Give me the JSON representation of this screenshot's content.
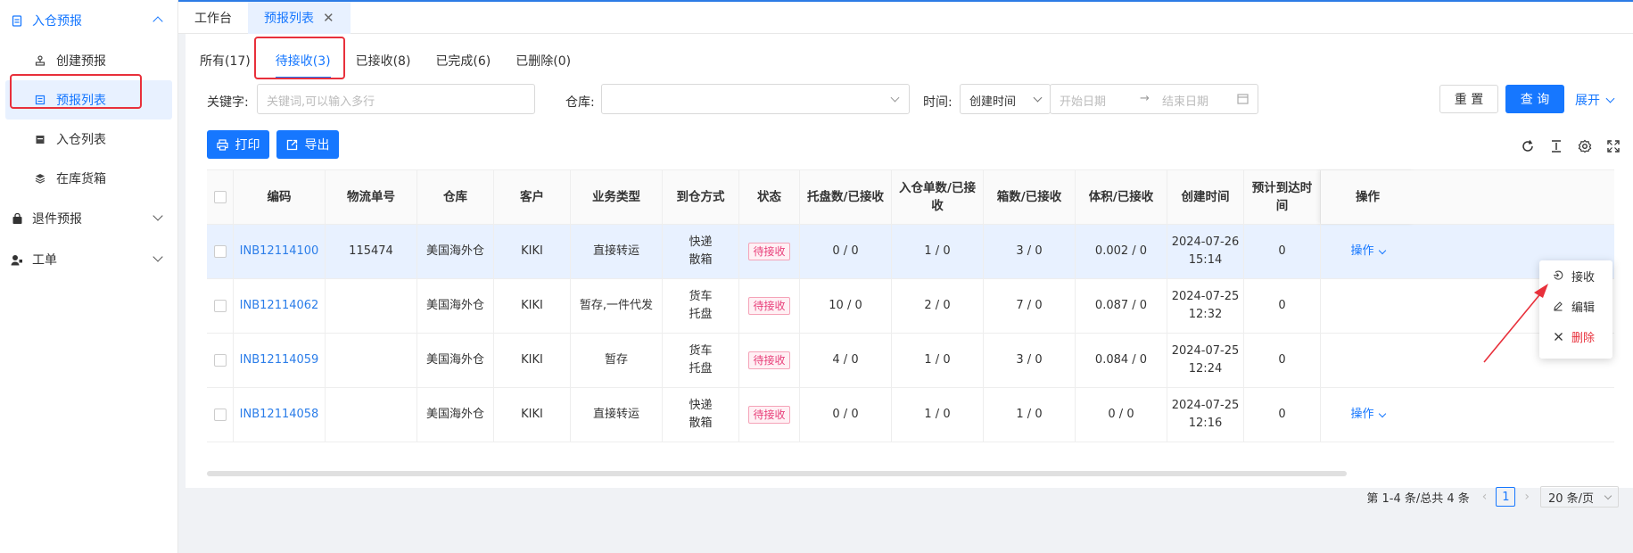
{
  "sidebar": {
    "groups": [
      {
        "label": "入仓预报",
        "icon": "document-icon",
        "open": true
      },
      {
        "label": "退件预报",
        "icon": "bag-icon"
      },
      {
        "label": "工单",
        "icon": "user-wrench-icon"
      }
    ],
    "items": [
      {
        "label": "创建预报",
        "icon": "stamp-icon"
      },
      {
        "label": "预报列表",
        "icon": "list-icon",
        "active": true
      },
      {
        "label": "入仓列表",
        "icon": "calendar-icon"
      },
      {
        "label": "在库货箱",
        "icon": "stack-icon"
      }
    ]
  },
  "top_tabs": [
    {
      "label": "工作台"
    },
    {
      "label": "预报列表",
      "active": true,
      "close": "✕"
    }
  ],
  "status_tabs": [
    {
      "label": "所有(17)"
    },
    {
      "label": "待接收(3)",
      "active": true
    },
    {
      "label": "已接收(8)"
    },
    {
      "label": "已完成(6)"
    },
    {
      "label": "已删除(0)"
    }
  ],
  "filters": {
    "keyword_label": "关键字:",
    "keyword_placeholder": "关键词,可以输入多行",
    "warehouse_label": "仓库:",
    "time_label": "时间:",
    "time_type": "创建时间",
    "start_placeholder": "开始日期",
    "arrow": "→",
    "end_placeholder": "结束日期",
    "reset": "重 置",
    "query": "查 询",
    "expand": "展开"
  },
  "actions": {
    "print": "打印",
    "export": "导出"
  },
  "table": {
    "headers": [
      "编码",
      "物流单号",
      "仓库",
      "客户",
      "业务类型",
      "到仓方式",
      "状态",
      "托盘数/已接收",
      "入仓单数/已接收",
      "箱数/已接收",
      "体积/已接收",
      "创建时间",
      "预计到达时间",
      "操作"
    ],
    "rows": [
      {
        "code": "INB12114100",
        "tracking": "115474",
        "warehouse": "美国海外仓",
        "customer": "KIKI",
        "biz": "直接转运",
        "arrival1": "快递",
        "arrival2": "散箱",
        "status": "待接收",
        "pallets": "0 / 0",
        "orders": "1 / 0",
        "boxes": "3 / 0",
        "volume": "0.002 / 0",
        "date": "2024-07-26",
        "time": "15:14",
        "eta": "0",
        "op": "操作"
      },
      {
        "code": "INB12114062",
        "tracking": "",
        "warehouse": "美国海外仓",
        "customer": "KIKI",
        "biz": "暂存,一件代发",
        "arrival1": "货车",
        "arrival2": "托盘",
        "status": "待接收",
        "pallets": "10 / 0",
        "orders": "2 / 0",
        "boxes": "7 / 0",
        "volume": "0.087 / 0",
        "date": "2024-07-25",
        "time": "12:32",
        "eta": "0",
        "op": ""
      },
      {
        "code": "INB12114059",
        "tracking": "",
        "warehouse": "美国海外仓",
        "customer": "KIKI",
        "biz": "暂存",
        "arrival1": "货车",
        "arrival2": "托盘",
        "status": "待接收",
        "pallets": "4 / 0",
        "orders": "1 / 0",
        "boxes": "3 / 0",
        "volume": "0.084 / 0",
        "date": "2024-07-25",
        "time": "12:24",
        "eta": "0",
        "op": ""
      },
      {
        "code": "INB12114058",
        "tracking": "",
        "warehouse": "美国海外仓",
        "customer": "KIKI",
        "biz": "直接转运",
        "arrival1": "快递",
        "arrival2": "散箱",
        "status": "待接收",
        "pallets": "0 / 0",
        "orders": "1 / 0",
        "boxes": "1 / 0",
        "volume": "0 / 0",
        "date": "2024-07-25",
        "time": "12:16",
        "eta": "0",
        "op": "操作"
      }
    ]
  },
  "dropdown": {
    "items": [
      {
        "label": "接收",
        "icon": "receive-icon"
      },
      {
        "label": "编辑",
        "icon": "edit-icon"
      },
      {
        "label": "删除",
        "icon": "close-icon"
      }
    ]
  },
  "pagination": {
    "summary": "第 1-4 条/总共 4 条",
    "prev": "‹",
    "page": "1",
    "next": "›",
    "page_size": "20 条/页"
  },
  "colors": {
    "primary": "#1677ff",
    "highlight": "#e8303b",
    "status_tag": "#e8407a"
  }
}
